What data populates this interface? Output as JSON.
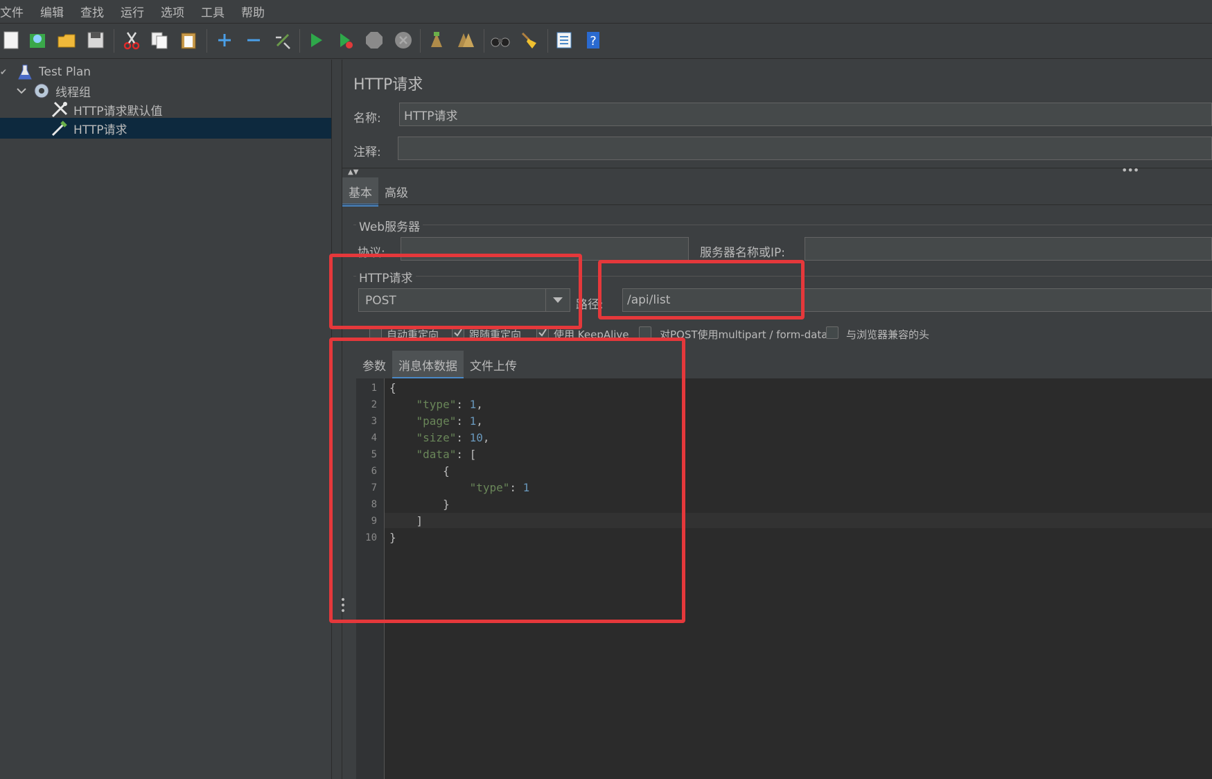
{
  "menu": [
    "文件",
    "编辑",
    "查找",
    "运行",
    "选项",
    "工具",
    "帮助"
  ],
  "tree": {
    "items": [
      {
        "label": "Test Plan",
        "icon": "flask-icon"
      },
      {
        "label": "线程组",
        "icon": "gear-icon"
      },
      {
        "label": "HTTP请求默认值",
        "icon": "wrench-icon"
      },
      {
        "label": "HTTP请求",
        "icon": "pipette-icon"
      }
    ]
  },
  "panel": {
    "title": "HTTP请求",
    "name_label": "名称:",
    "name_value": "HTTP请求",
    "comment_label": "注释:",
    "comment_value": "",
    "tabs": [
      "基本",
      "高级"
    ],
    "web_server": {
      "title": "Web服务器",
      "protocol_label": "协议:",
      "protocol_value": "",
      "server_label": "服务器名称或IP:",
      "server_value": ""
    },
    "http_request": {
      "title": "HTTP请求",
      "method": "POST",
      "path_label": "路径:",
      "path_value": "/api/list"
    },
    "options": [
      {
        "label": "自动重定向",
        "checked": false
      },
      {
        "label": "跟随重定向",
        "checked": true
      },
      {
        "label": "使用 KeepAlive",
        "checked": true
      },
      {
        "label": "对POST使用multipart / form-data",
        "checked": false
      },
      {
        "label": "与浏览器兼容的头",
        "checked": false
      }
    ],
    "body_tabs": [
      "参数",
      "消息体数据",
      "文件上传"
    ],
    "body_lines": [
      {
        "n": "1",
        "text": "{"
      },
      {
        "n": "2",
        "text": "    \"type\": 1,"
      },
      {
        "n": "3",
        "text": "    \"page\": 1,"
      },
      {
        "n": "4",
        "text": "    \"size\": 10,"
      },
      {
        "n": "5",
        "text": "    \"data\": ["
      },
      {
        "n": "6",
        "text": "        {"
      },
      {
        "n": "7",
        "text": "            \"type\": 1"
      },
      {
        "n": "8",
        "text": "        }"
      },
      {
        "n": "9",
        "text": "    ]"
      },
      {
        "n": "10",
        "text": "}"
      }
    ]
  },
  "colors": {
    "highlight": "#e5383b",
    "selection": "#0d293e",
    "accent": "#4a88c7"
  }
}
